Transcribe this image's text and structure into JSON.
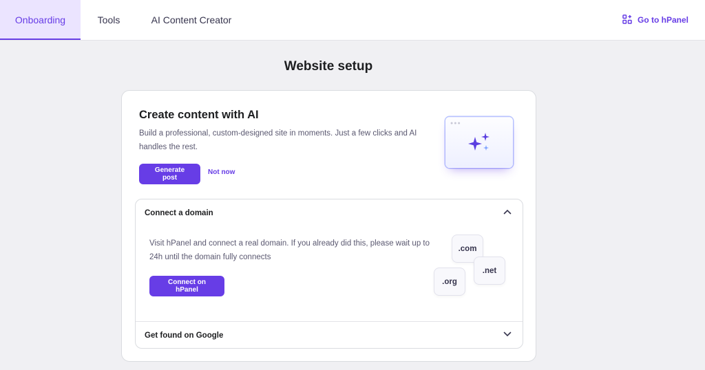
{
  "nav": {
    "tabs": [
      {
        "label": "Onboarding",
        "active": true
      },
      {
        "label": "Tools",
        "active": false
      },
      {
        "label": "AI Content Creator",
        "active": false
      }
    ],
    "hpanel_link": "Go to hPanel",
    "hpanel_icon": "grid-apps-icon"
  },
  "page": {
    "title": "Website setup"
  },
  "ai_card": {
    "title": "Create content with AI",
    "description": "Build a professional, custom-designed site in moments. Just a few clicks and AI handles the rest.",
    "primary_button": "Generate post",
    "secondary_button": "Not now",
    "illustration_icon": "sparkles-icon"
  },
  "accordion": {
    "domain": {
      "title": "Connect a domain",
      "expanded": true,
      "description": "Visit hPanel and connect a real domain. If you already did this, please wait up to 24h until the domain fully connects",
      "button": "Connect on hPanel",
      "tlds": [
        ".com",
        ".net",
        ".org"
      ]
    },
    "google": {
      "title": "Get found on Google",
      "expanded": false
    }
  },
  "colors": {
    "accent": "#673de6",
    "active_tab_bg": "#ebe4ff",
    "page_bg": "#f0f0f3",
    "text": "#1d1e20",
    "muted_text": "#5a5870"
  }
}
